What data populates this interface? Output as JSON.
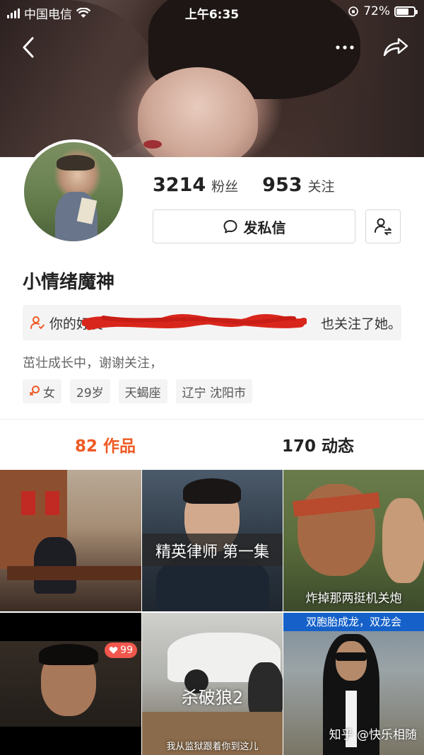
{
  "status_bar": {
    "carrier": "中国电信",
    "time": "上午6:35",
    "battery": "72%",
    "battery_level": 0.72
  },
  "profile": {
    "followers_count": "3214",
    "followers_label": "粉丝",
    "following_count": "953",
    "following_label": "关注",
    "message_button": "发私信",
    "name": "小情绪魔神",
    "friend_prefix": "你的好友",
    "friend_suffix": "也关注了她。",
    "bio": "茁壮成长中，谢谢关注，",
    "tags": [
      "女",
      "29岁",
      "天蝎座",
      "辽宁 沈阳市"
    ]
  },
  "tabs": {
    "works_count": "82",
    "works_label": "作品",
    "dynamic_count": "170",
    "dynamic_label": "动态"
  },
  "grid": {
    "items": [
      {
        "caption": ""
      },
      {
        "caption": "精英律师 第一集"
      },
      {
        "caption": "炸掉那两挺机关炮"
      },
      {
        "caption": "",
        "likes": "99"
      },
      {
        "caption": "杀破狼2",
        "subtitle": "我从监狱跟着你到这儿"
      },
      {
        "caption": "",
        "top_label": "双胞胎成龙，双龙会"
      }
    ],
    "watermark": "知乎 @快乐相随"
  },
  "colors": {
    "accent": "#ee5a24",
    "badge": "#f1574d",
    "redaction": "#d9261c"
  },
  "icons": [
    "back-icon",
    "more-icon",
    "share-icon",
    "message-icon",
    "follow-settings-icon",
    "friend-icon",
    "gender-female-icon",
    "heart-icon",
    "signal-icon",
    "wifi-icon",
    "rotation-lock-icon",
    "battery-icon"
  ]
}
